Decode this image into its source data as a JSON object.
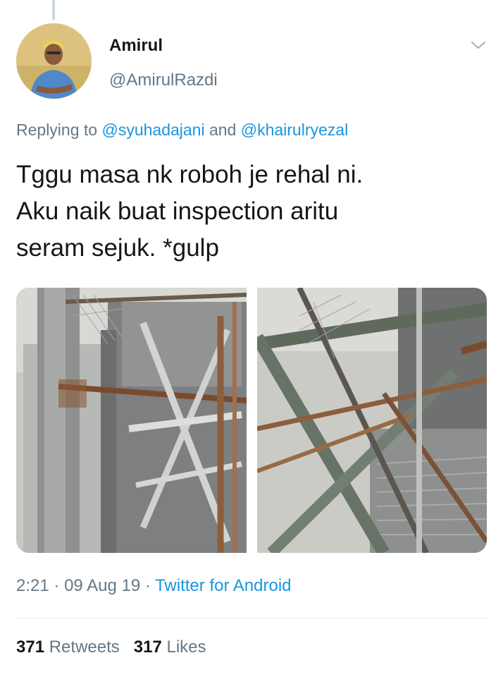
{
  "author": {
    "name": "Amirul",
    "handle": "@AmirulRazdi",
    "avatar_icon": "person-avatar"
  },
  "reply_context": {
    "prefix": "Replying to",
    "mention_1": "@syuhadajani",
    "conjunction": "and",
    "mention_2": "@khairulryezal"
  },
  "tweet": {
    "lines": [
      "Tggu masa nk roboh je rehal ni.",
      "Aku naik buat inspection aritu",
      "seram sejuk. *gulp"
    ]
  },
  "media": {
    "image_1_icon": "steel-structure-photo",
    "image_2_icon": "steel-structure-photo"
  },
  "meta": {
    "time": "2:21",
    "separator": "·",
    "date": "09 Aug 19",
    "source": "Twitter for Android"
  },
  "stats": {
    "retweets_count": "371",
    "retweets_label": "Retweets",
    "likes_count": "317",
    "likes_label": "Likes"
  },
  "colors": {
    "link": "#1b95e0",
    "secondary_text": "#657786",
    "primary_text": "#14171a"
  }
}
